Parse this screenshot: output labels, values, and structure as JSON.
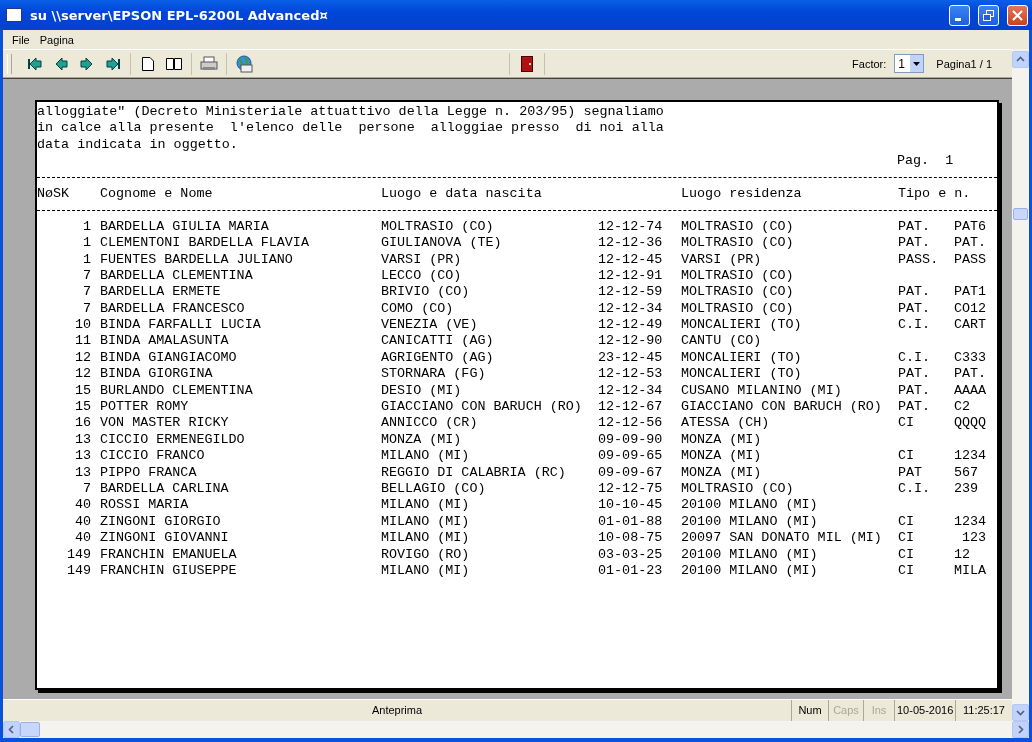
{
  "window": {
    "title": "su \\\\server\\EPSON EPL-6200L Advanced¤"
  },
  "menu": [
    "File",
    "Pagina"
  ],
  "toolbar": {
    "factor_label": "Factor:",
    "factor_value": "1",
    "page_label": "Pagina1 / 1"
  },
  "document": {
    "intro": [
      "alloggiate\" (Decreto Ministeriale attuattivo della Legge n. 203/95) segnaliamo",
      "in calce alla presente  l'elenco delle  persone  alloggiae presso  di noi alla",
      "data indicata in oggetto."
    ],
    "page_number": "Pag.  1",
    "columns": [
      "NøSK",
      "Cognome e Nome",
      "Luogo e data nascita",
      "",
      "Luogo residenza",
      "Tipo e n.",
      ""
    ],
    "rows": [
      [
        "1",
        "BARDELLA GIULIA MARIA",
        "MOLTRASIO (CO)",
        "12-12-74",
        "MOLTRASIO (CO)",
        "PAT.",
        "PAT6"
      ],
      [
        "1",
        "CLEMENTONI BARDELLA FLAVIA",
        "GIULIANOVA (TE)",
        "12-12-36",
        "MOLTRASIO (CO)",
        "PAT.",
        "PAT."
      ],
      [
        "1",
        "FUENTES BARDELLA JULIANO",
        "VARSI (PR)",
        "12-12-45",
        "VARSI (PR)",
        "PASS.",
        "PASS"
      ],
      [
        "7",
        "BARDELLA CLEMENTINA",
        "LECCO (CO)",
        "12-12-91",
        "MOLTRASIO (CO)",
        "",
        ""
      ],
      [
        "7",
        "BARDELLA ERMETE",
        "BRIVIO (CO)",
        "12-12-59",
        "MOLTRASIO (CO)",
        "PAT.",
        "PAT1"
      ],
      [
        "7",
        "BARDELLA FRANCESCO",
        "COMO (CO)",
        "12-12-34",
        "MOLTRASIO (CO)",
        "PAT.",
        "CO12"
      ],
      [
        "10",
        "BINDA FARFALLI LUCIA",
        "VENEZIA (VE)",
        "12-12-49",
        "MONCALIERI (TO)",
        "C.I.",
        "CART"
      ],
      [
        "11",
        "BINDA AMALASUNTA",
        "CANICATTI (AG)",
        "12-12-90",
        "CANTU (CO)",
        "",
        ""
      ],
      [
        "12",
        "BINDA GIANGIACOMO",
        "AGRIGENTO (AG)",
        "23-12-45",
        "MONCALIERI (TO)",
        "C.I.",
        "C333"
      ],
      [
        "12",
        "BINDA GIORGINA",
        "STORNARA (FG)",
        "12-12-53",
        "MONCALIERI (TO)",
        "PAT.",
        "PAT."
      ],
      [
        "15",
        "BURLANDO CLEMENTINA",
        "DESIO (MI)",
        "12-12-34",
        "CUSANO MILANINO (MI)",
        "PAT.",
        "AAAA"
      ],
      [
        "15",
        "POTTER ROMY",
        "GIACCIANO CON BARUCH (RO)",
        "12-12-67",
        "GIACCIANO CON BARUCH (RO)",
        "PAT.",
        "C2"
      ],
      [
        "16",
        "VON MASTER RICKY",
        "ANNICCO (CR)",
        "12-12-56",
        "ATESSA (CH)",
        "CI",
        "QQQQ"
      ],
      [
        "13",
        "CICCIO ERMENEGILDO",
        "MONZA (MI)",
        "09-09-90",
        "MONZA (MI)",
        "",
        ""
      ],
      [
        "13",
        "CICCIO FRANCO",
        "MILANO (MI)",
        "09-09-65",
        "MONZA (MI)",
        "CI",
        "1234"
      ],
      [
        "13",
        "PIPPO FRANCA",
        "REGGIO DI CALABRIA (RC)",
        "09-09-67",
        "MONZA (MI)",
        "PAT",
        "567"
      ],
      [
        "7",
        "BARDELLA CARLINA",
        "BELLAGIO (CO)",
        "12-12-75",
        "MOLTRASIO (CO)",
        "C.I.",
        "239"
      ],
      [
        "40",
        "ROSSI MARIA",
        "MILANO (MI)",
        "10-10-45",
        "20100 MILANO (MI)",
        "",
        ""
      ],
      [
        "40",
        "ZINGONI GIORGIO",
        "MILANO (MI)",
        "01-01-88",
        "20100 MILANO (MI)",
        "CI",
        "1234"
      ],
      [
        "40",
        "ZINGONI GIOVANNI",
        "MILANO (MI)",
        "10-08-75",
        "20097 SAN DONATO MIL (MI)",
        "CI",
        " 123"
      ],
      [
        "149",
        "FRANCHIN EMANUELA",
        "ROVIGO (RO)",
        "03-03-25",
        "20100 MILANO (MI)",
        "CI",
        "12"
      ],
      [
        "149",
        "FRANCHIN GIUSEPPE",
        "MILANO (MI)",
        "01-01-23",
        "20100 MILANO (MI)",
        "CI",
        "MILA"
      ]
    ]
  },
  "status_bar": {
    "message": "Anteprima",
    "indicators": [
      {
        "label": "Num",
        "enabled": true
      },
      {
        "label": "Caps",
        "enabled": false
      },
      {
        "label": "Ins",
        "enabled": false
      }
    ],
    "date": "10-05-2016",
    "time": "11:25:17"
  }
}
